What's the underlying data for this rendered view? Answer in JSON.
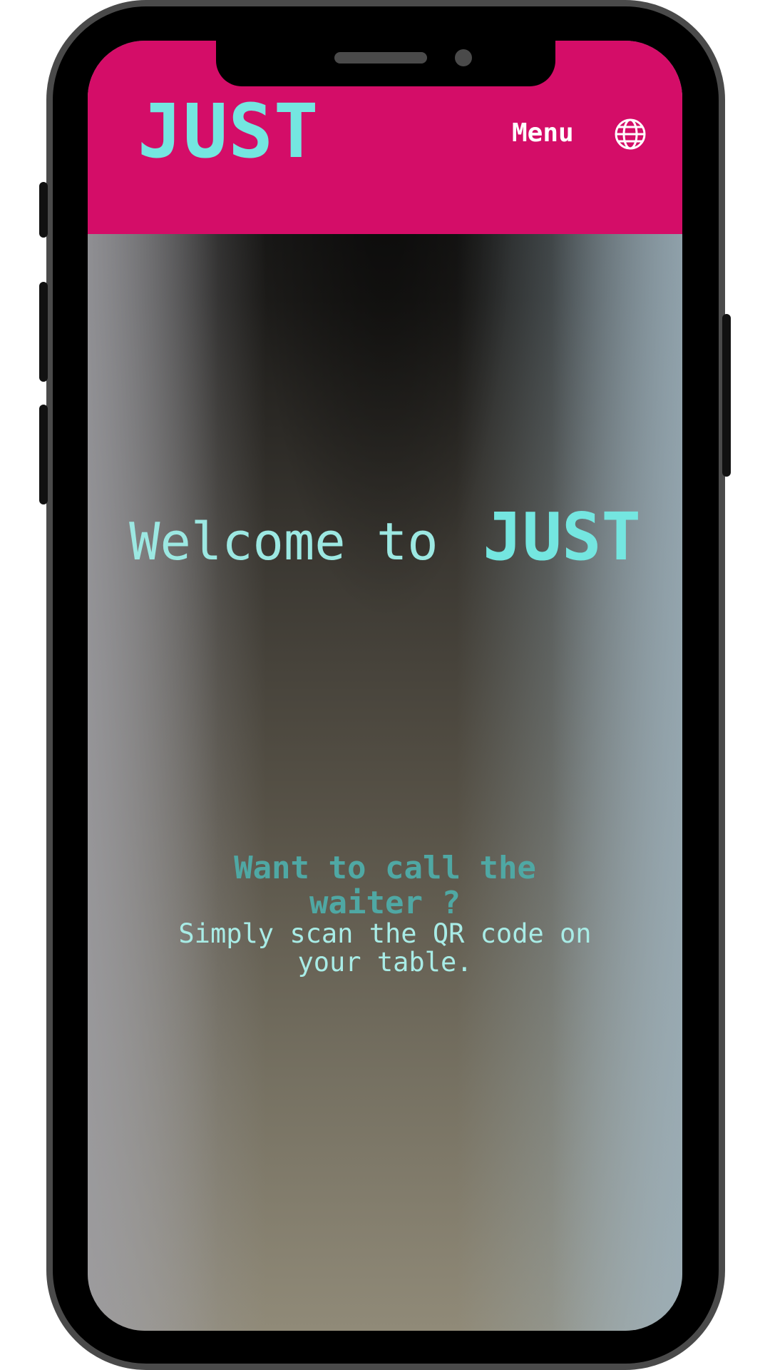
{
  "header": {
    "logo": "JUST",
    "menu_label": "Menu",
    "language_icon": "globe-icon"
  },
  "hero": {
    "welcome_text": "Welcome to",
    "brand": "JUST"
  },
  "cta": {
    "title_line1": "Want to call the",
    "title_line2": "waiter ?",
    "subtitle_line1": "Simply scan the QR code on",
    "subtitle_line2": "your table."
  },
  "colors": {
    "header_bg": "#d40d68",
    "brand_teal": "#74e6e0",
    "cta_title": "#4fa8a4",
    "cta_subtitle": "#a8ece6"
  }
}
